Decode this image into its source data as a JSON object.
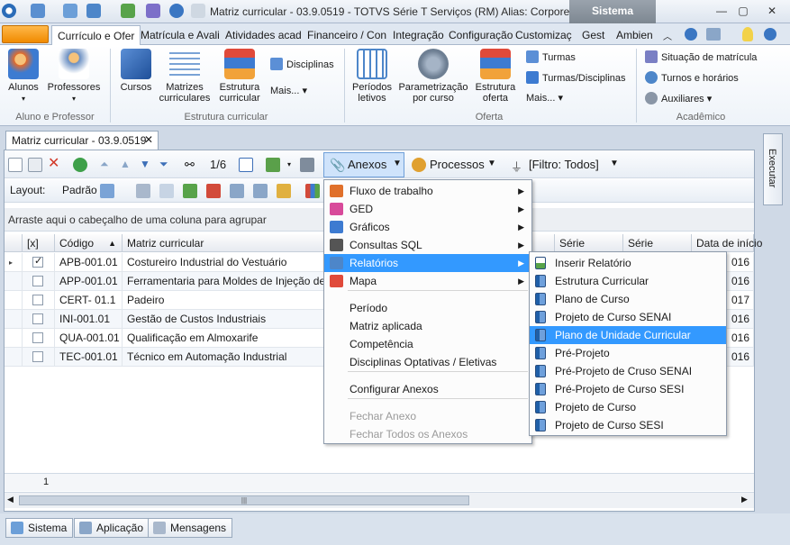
{
  "window": {
    "title": "Matriz curricular - 03.9.0519 - TOTVS Série T Serviços (RM) Alias: CorporeRM_Ca...",
    "context_tab": "Sistema"
  },
  "ribbon_tabs": [
    {
      "label": "Currículo e Ofer",
      "active": true
    },
    {
      "label": "Matrícula e Avali"
    },
    {
      "label": "Atividades acad"
    },
    {
      "label": "Financeiro / Con"
    },
    {
      "label": "Integração"
    },
    {
      "label": "Configuração"
    },
    {
      "label": "Customizaç"
    },
    {
      "label": "Gest"
    },
    {
      "label": "Ambien"
    }
  ],
  "ribbon": {
    "groups": [
      {
        "label": "Aluno e Professor",
        "buttons": [
          "Alunos",
          "Professores"
        ]
      },
      {
        "label": "Estrutura curricular",
        "buttons": [
          "Cursos",
          "Matrizes curriculares",
          "Estrutura curricular"
        ],
        "small": [
          "Disciplinas",
          "Mais..."
        ]
      },
      {
        "label": "Oferta",
        "buttons": [
          "Períodos letivos",
          "Parametrização por curso",
          "Estrutura oferta"
        ],
        "small": [
          "Turmas",
          "Turmas/Disciplinas",
          "Mais..."
        ]
      },
      {
        "label": "Acadêmico",
        "small": [
          "Situação de matrícula",
          "Turnos e horários",
          "Auxiliares"
        ]
      }
    ]
  },
  "document_tab": {
    "label": "Matriz curricular - 03.9.0519"
  },
  "toolbar": {
    "page_counter": "1/6",
    "anexos": "Anexos",
    "processos": "Processos",
    "filtro": "[Filtro: Todos]"
  },
  "toolbar2": {
    "layout_label": "Layout:",
    "layout_value": "Padrão"
  },
  "group_hint": "Arraste aqui o cabeçalho de uma coluna para agrupar",
  "grid": {
    "headers": [
      "[x]",
      "Código",
      "Matriz curricular",
      "Série",
      "Série",
      "Data de início"
    ],
    "rows": [
      {
        "checked": true,
        "codigo": "APB-001.01",
        "matriz": "Costureiro Industrial do Vestuário",
        "data": "016"
      },
      {
        "checked": false,
        "codigo": "APP-001.01",
        "matriz": "Ferramentaria para Moldes de Injeção de...",
        "data": "016"
      },
      {
        "checked": false,
        "codigo": "CERT- 01.1",
        "matriz": "Padeiro",
        "data": "017"
      },
      {
        "checked": false,
        "codigo": "INI-001.01",
        "matriz": "Gestão de Custos Industriais",
        "data": "016"
      },
      {
        "checked": false,
        "codigo": "QUA-001.01",
        "matriz": "Qualificação em Almoxarife",
        "data": "016"
      },
      {
        "checked": false,
        "codigo": "TEC-001.01",
        "matriz": "Técnico em Automação Industrial",
        "data": "016"
      }
    ],
    "footer_count": "1"
  },
  "anexos_menu": {
    "items": [
      {
        "label": "Fluxo de trabalho",
        "submenu": true
      },
      {
        "label": "GED",
        "submenu": true
      },
      {
        "label": "Gráficos",
        "submenu": true
      },
      {
        "label": "Consultas SQL",
        "submenu": true
      },
      {
        "label": "Relatórios",
        "submenu": true,
        "highlighted": true
      },
      {
        "label": "Mapa",
        "submenu": true
      },
      {
        "label": "Período"
      },
      {
        "label": "Matriz aplicada"
      },
      {
        "label": "Competência"
      },
      {
        "label": "Disciplinas Optativas / Eletivas"
      },
      {
        "label": "Configurar Anexos"
      },
      {
        "label": "Fechar Anexo",
        "disabled": true
      },
      {
        "label": "Fechar Todos os Anexos",
        "disabled": true
      }
    ]
  },
  "relatorios_menu": {
    "items": [
      {
        "label": "Inserir Relatório"
      },
      {
        "label": "Estrutura Curricular"
      },
      {
        "label": "Plano de Curso"
      },
      {
        "label": "Projeto de Curso SENAI"
      },
      {
        "label": "Plano de Unidade Curricular",
        "highlighted": true
      },
      {
        "label": "Pré-Projeto"
      },
      {
        "label": "Pré-Projeto de Cruso SENAI"
      },
      {
        "label": "Pré-Projeto de Curso SESI"
      },
      {
        "label": "Projeto de Curso"
      },
      {
        "label": "Projeto de Curso SESI"
      }
    ]
  },
  "side_pane": {
    "label": "Executar"
  },
  "statusbar": {
    "buttons": [
      "Sistema",
      "Aplicação",
      "Mensagens"
    ]
  },
  "colors": {
    "highlight": "#3399ff",
    "app_button": "#f08a00",
    "context_tab": "#8a939d"
  }
}
